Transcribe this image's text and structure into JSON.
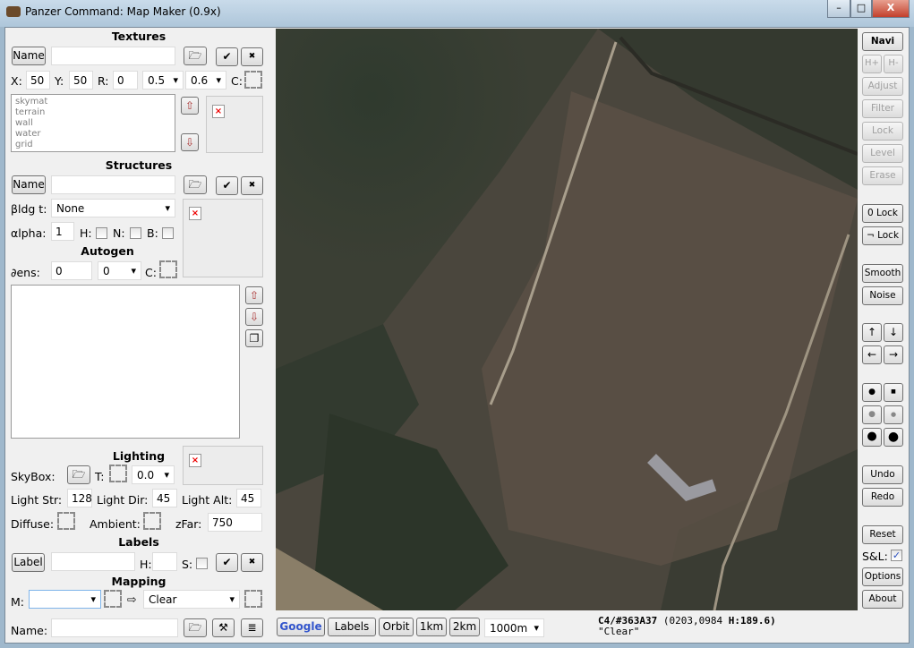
{
  "window": {
    "title": "Panzer Command: Map Maker (0.9x)",
    "minimize": "–",
    "maximize": "□",
    "close": "X"
  },
  "textures": {
    "heading": "Textures",
    "name_button": "Name",
    "name_value": "",
    "x_label": "X:",
    "x_value": "50",
    "y_label": "Y:",
    "y_value": "50",
    "r_label": "R:",
    "r_value": "0",
    "scale1": "0.5",
    "scale2": "0.6",
    "c_label": "C:",
    "items": [
      "skymat",
      "terrain",
      "wall",
      "water",
      "grid"
    ]
  },
  "structures": {
    "heading": "Structures",
    "name_button": "Name",
    "name_value": "",
    "bldg_label": "βldg t:",
    "bldg_value": "None",
    "alpha_label": "αlpha:",
    "alpha_value": "1",
    "h_label": "H:",
    "n_label": "N:",
    "b_label": "B:"
  },
  "autogen": {
    "heading": "Autogen",
    "dens_label": "∂ens:",
    "dens_value": "0",
    "dens_select": "0",
    "c_label": "C:"
  },
  "lighting": {
    "heading": "Lighting",
    "skybox_label": "SkyBox:",
    "t_label": "T:",
    "t_value": "0.0",
    "str_label": "Light Str:",
    "str_value": "128",
    "dir_label": "Light Dir:",
    "dir_value": "45",
    "alt_label": "Light Alt:",
    "alt_value": "45",
    "diffuse_label": "Diffuse:",
    "ambient_label": "Ambient:",
    "zfar_label": "zFar:",
    "zfar_value": "750"
  },
  "labels": {
    "heading": "Labels",
    "label_button": "Label",
    "label_value": "",
    "h_label": "H:",
    "h_value": "",
    "s_label": "S:"
  },
  "mapping": {
    "heading": "Mapping",
    "m_label": "M:",
    "m_value": "",
    "target_value": "Clear",
    "name_label": "Name:",
    "name_value": ""
  },
  "icons": {
    "ok": "✔",
    "cancel": "✖",
    "arrow": "⇨",
    "up": "⇧",
    "down": "⇩"
  },
  "right": {
    "navi": "Navi",
    "hplus": "H+",
    "hminus": "H-",
    "adjust": "Adjust",
    "filter": "Filter",
    "lock": "Lock",
    "level": "Level",
    "erase": "Erase",
    "zero_lock": "0 Lock",
    "not_lock": "¬ Lock",
    "smooth": "Smooth",
    "noise": "Noise",
    "undo": "Undo",
    "redo": "Redo",
    "reset": "Reset",
    "sl_label": "S&L:",
    "options": "Options",
    "about": "About"
  },
  "bottom": {
    "google": "Google",
    "labels": "Labels",
    "orbit": "Orbit",
    "km1": "1km",
    "km2": "2km",
    "range": "1000m",
    "status_cell": "C4/#363A37",
    "status_coords": "(0203,0984",
    "status_height": "H:189.6)",
    "status_name": "\"Clear\""
  }
}
